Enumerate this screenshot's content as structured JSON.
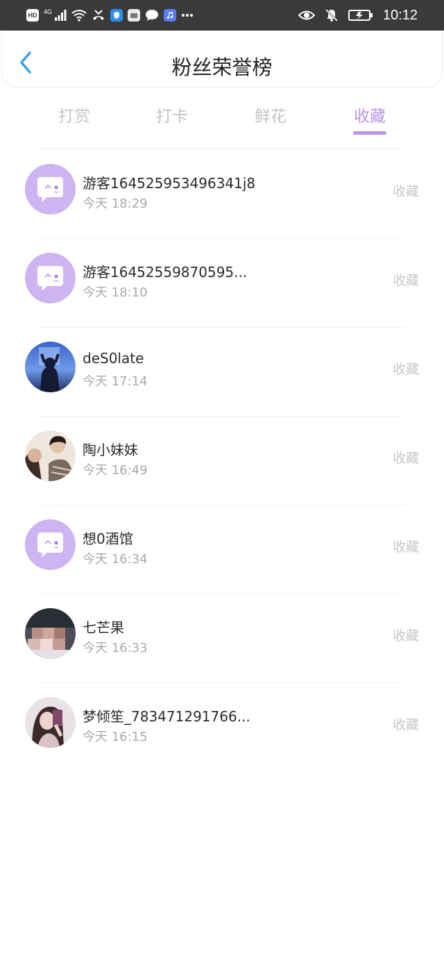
{
  "status_bar": {
    "network_label": "4G",
    "hd_label": "HD",
    "time": "10:12"
  },
  "header": {
    "title": "粉丝荣誉榜",
    "back_icon": "chevron-left-icon"
  },
  "tabs": [
    {
      "label": "打赏",
      "active": false
    },
    {
      "label": "打卡",
      "active": false
    },
    {
      "label": "鲜花",
      "active": false
    },
    {
      "label": "收藏",
      "active": true
    }
  ],
  "colors": {
    "accent": "#b995e6",
    "back_arrow": "#3b9fe6",
    "avatar_default_bg": "#cdb4f3"
  },
  "list": [
    {
      "name": "游客164525953496341j8",
      "time": "今天 18:29",
      "action": "收藏",
      "avatar": "default-chat-bubble"
    },
    {
      "name": "游客16452559870595...",
      "time": "今天 18:10",
      "action": "收藏",
      "avatar": "default-chat-bubble"
    },
    {
      "name": "deS0late",
      "time": "今天 17:14",
      "action": "收藏",
      "avatar": "photo-blue"
    },
    {
      "name": "陶小妹妹",
      "time": "今天 16:49",
      "action": "收藏",
      "avatar": "photo-couple"
    },
    {
      "name": "想0酒馆",
      "time": "今天 16:34",
      "action": "收藏",
      "avatar": "default-chat-bubble"
    },
    {
      "name": "七芒果",
      "time": "今天 16:33",
      "action": "收藏",
      "avatar": "photo-pixelated"
    },
    {
      "name": "梦倾笙_783471291766...",
      "time": "今天 16:15",
      "action": "收藏",
      "avatar": "photo-girl"
    }
  ]
}
